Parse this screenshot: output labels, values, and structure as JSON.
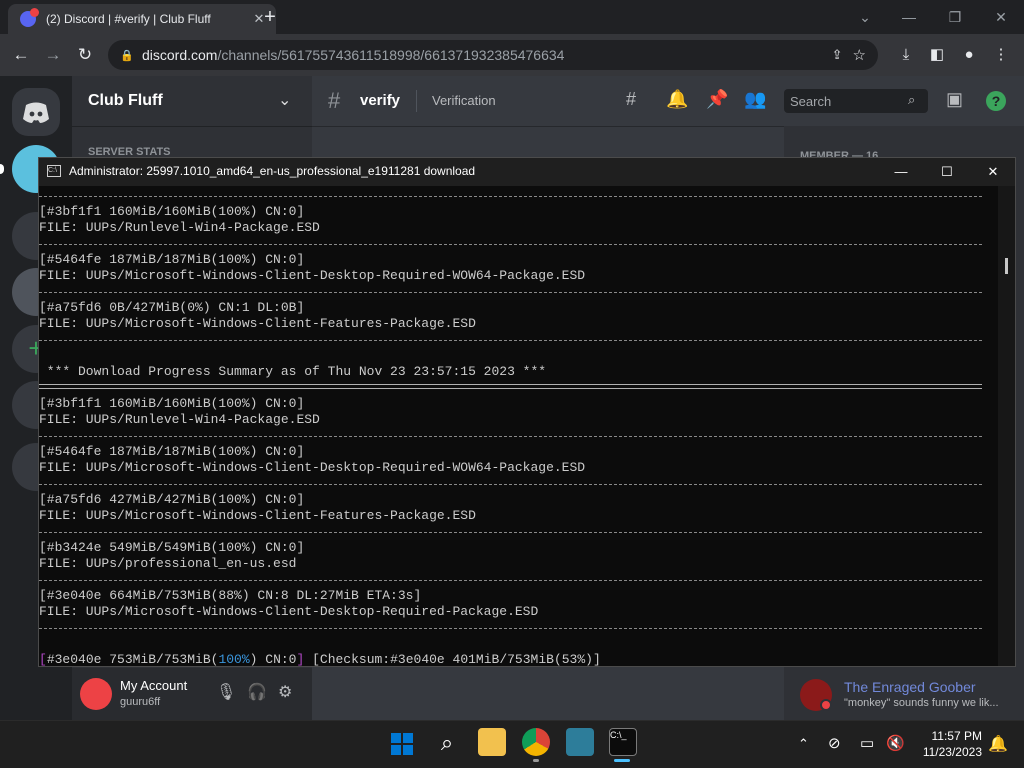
{
  "browser": {
    "tab_title": "(2) Discord | #verify | Club Fluff",
    "url_host": "discord.com",
    "url_path": "/channels/561755743611518998/661371932385476634"
  },
  "discord": {
    "server_name": "Club Fluff",
    "channel_name": "verify",
    "channel_topic": "Verification",
    "search_placeholder": "Search",
    "category_label": "SERVER STATS",
    "member_header": "MEMBER — 16",
    "account_name": "My Account",
    "account_tag": "guuru6ff",
    "member_name": "The Enraged Goober",
    "member_status": "\"monkey\" sounds funny we lik..."
  },
  "console": {
    "title": "Administrator:  25997.1010_amd64_en-us_professional_e1911281 download",
    "lines": {
      "l1": "[#3bf1f1 160MiB/160MiB(100%) CN:0]",
      "l2": "FILE: UUPs/Runlevel-Win4-Package.ESD",
      "l3": "[#5464fe 187MiB/187MiB(100%) CN:0]",
      "l4": "FILE: UUPs/Microsoft-Windows-Client-Desktop-Required-WOW64-Package.ESD",
      "l5": "[#a75fd6 0B/427MiB(0%) CN:1 DL:0B]",
      "l6": "FILE: UUPs/Microsoft-Windows-Client-Features-Package.ESD",
      "l7": " *** Download Progress Summary as of Thu Nov 23 23:57:15 2023 ***",
      "l8": "[#3bf1f1 160MiB/160MiB(100%) CN:0]",
      "l9": "FILE: UUPs/Runlevel-Win4-Package.ESD",
      "l10": "[#5464fe 187MiB/187MiB(100%) CN:0]",
      "l11": "FILE: UUPs/Microsoft-Windows-Client-Desktop-Required-WOW64-Package.ESD",
      "l12": "[#a75fd6 427MiB/427MiB(100%) CN:0]",
      "l13": "FILE: UUPs/Microsoft-Windows-Client-Features-Package.ESD",
      "l14": "[#b3424e 549MiB/549MiB(100%) CN:0]",
      "l15": "FILE: UUPs/professional_en-us.esd",
      "l16": "[#3e040e 664MiB/753MiB(88%) CN:8 DL:27MiB ETA:3s]",
      "l17": "FILE: UUPs/Microsoft-Windows-Client-Desktop-Required-Package.ESD",
      "p1": "[",
      "p2": "#3e040e 753MiB/753MiB(",
      "p3": "100%",
      "p4": ") CN:0",
      "p5": "]",
      "p6": " [Checksum:#3e040e 401MiB/753MiB(53%)]"
    }
  },
  "taskbar": {
    "time": "11:57 PM",
    "date": "11/23/2023"
  },
  "colors": {
    "discord_blurple": "#5865f2",
    "console_bg": "#0c0c0c",
    "help_green": "#3ba55c",
    "member_name": "#7289da"
  }
}
